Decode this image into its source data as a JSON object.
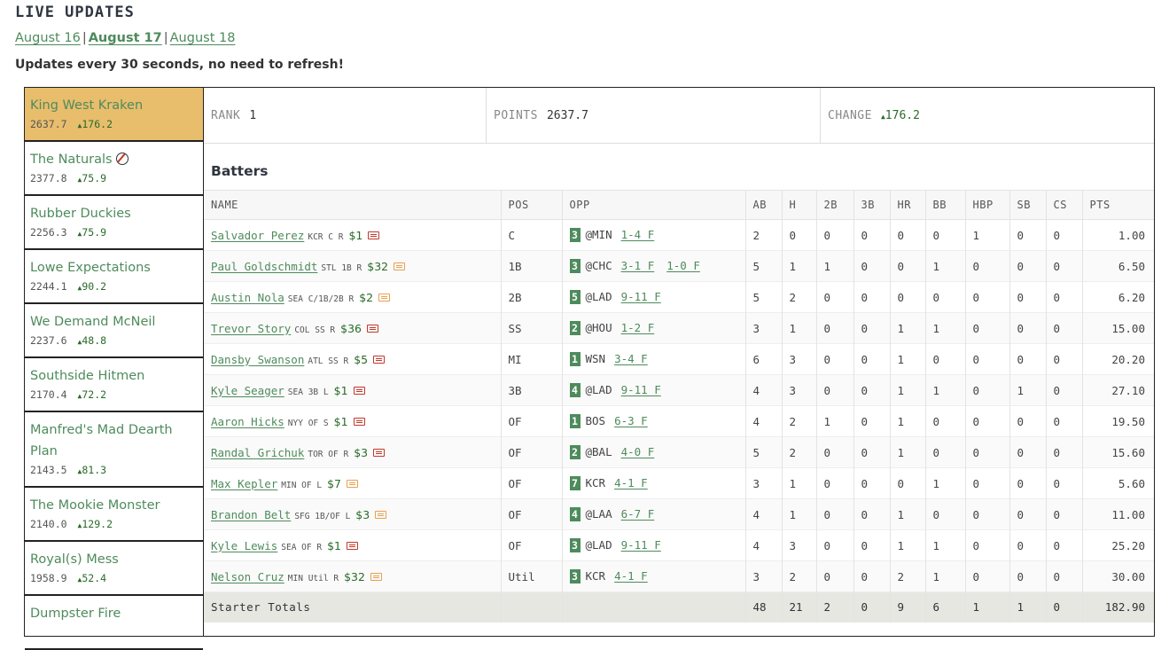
{
  "page_title": "LIVE UPDATES",
  "dates": [
    {
      "label": "August 16",
      "active": false
    },
    {
      "label": "August 17",
      "active": true
    },
    {
      "label": "August 18",
      "active": false
    }
  ],
  "date_separator": "|",
  "refresh_note": "Updates every 30 seconds, no need to refresh!",
  "teams": [
    {
      "name": "King West Kraken",
      "points": "2637.7",
      "change": "176.2",
      "active": true
    },
    {
      "name": "The Naturals",
      "points": "2377.8",
      "change": "75.9",
      "icon": "baseball-icon"
    },
    {
      "name": "Rubber Duckies",
      "points": "2256.3",
      "change": "75.9"
    },
    {
      "name": "Lowe Expectations",
      "points": "2244.1",
      "change": "90.2"
    },
    {
      "name": "We Demand McNeil",
      "points": "2237.6",
      "change": "48.8"
    },
    {
      "name": "Southside Hitmen",
      "points": "2170.4",
      "change": "72.2"
    },
    {
      "name": "Manfred's Mad Dearth Plan",
      "points": "2143.5",
      "change": "81.3"
    },
    {
      "name": "The Mookie Monster",
      "points": "2140.0",
      "change": "129.2"
    },
    {
      "name": "Royal(s) Mess",
      "points": "1958.9",
      "change": "52.4"
    },
    {
      "name": "Dumpster Fire",
      "points": "",
      "change": ""
    }
  ],
  "summary": {
    "rank_label": "RANK",
    "rank": "1",
    "points_label": "POINTS",
    "points": "2637.7",
    "change_label": "CHANGE",
    "change": "176.2"
  },
  "batters_title": "Batters",
  "columns": [
    "NAME",
    "POS",
    "OPP",
    "AB",
    "H",
    "2B",
    "3B",
    "HR",
    "BB",
    "HBP",
    "SB",
    "CS",
    "PTS"
  ],
  "batters": [
    {
      "name": "Salvador Perez",
      "team": "KCR",
      "elig": "C",
      "hand": "R",
      "salary": "$1",
      "card": "red",
      "pos": "C",
      "order": "3",
      "opp": "@MIN",
      "games": [
        "1-4 F"
      ],
      "stats": [
        "2",
        "0",
        "0",
        "0",
        "0",
        "0",
        "1",
        "0",
        "0"
      ],
      "pts": "1.00"
    },
    {
      "name": "Paul Goldschmidt",
      "team": "STL",
      "elig": "1B",
      "hand": "R",
      "salary": "$32",
      "card": "orange",
      "pos": "1B",
      "order": "3",
      "opp": "@CHC",
      "games": [
        "3-1 F",
        "1-0 F"
      ],
      "stats": [
        "5",
        "1",
        "1",
        "0",
        "0",
        "1",
        "0",
        "0",
        "0"
      ],
      "pts": "6.50"
    },
    {
      "name": "Austin Nola",
      "team": "SEA",
      "elig": "C/1B/2B",
      "hand": "R",
      "salary": "$2",
      "card": "orange",
      "pos": "2B",
      "order": "5",
      "opp": "@LAD",
      "games": [
        "9-11 F"
      ],
      "stats": [
        "5",
        "2",
        "0",
        "0",
        "0",
        "0",
        "0",
        "0",
        "0"
      ],
      "pts": "6.20"
    },
    {
      "name": "Trevor Story",
      "team": "COL",
      "elig": "SS",
      "hand": "R",
      "salary": "$36",
      "card": "red",
      "pos": "SS",
      "order": "2",
      "opp": "@HOU",
      "games": [
        "1-2 F"
      ],
      "stats": [
        "3",
        "1",
        "0",
        "0",
        "1",
        "1",
        "0",
        "0",
        "0"
      ],
      "pts": "15.00"
    },
    {
      "name": "Dansby Swanson",
      "team": "ATL",
      "elig": "SS",
      "hand": "R",
      "salary": "$5",
      "card": "red",
      "pos": "MI",
      "order": "1",
      "opp": "WSN",
      "games": [
        "3-4 F"
      ],
      "stats": [
        "6",
        "3",
        "0",
        "0",
        "1",
        "0",
        "0",
        "0",
        "0"
      ],
      "pts": "20.20"
    },
    {
      "name": "Kyle Seager",
      "team": "SEA",
      "elig": "3B",
      "hand": "L",
      "salary": "$1",
      "card": "red",
      "pos": "3B",
      "order": "4",
      "opp": "@LAD",
      "games": [
        "9-11 F"
      ],
      "stats": [
        "4",
        "3",
        "0",
        "0",
        "1",
        "1",
        "0",
        "1",
        "0"
      ],
      "pts": "27.10"
    },
    {
      "name": "Aaron Hicks",
      "team": "NYY",
      "elig": "OF",
      "hand": "S",
      "salary": "$1",
      "card": "red",
      "pos": "OF",
      "order": "1",
      "opp": "BOS",
      "games": [
        "6-3 F"
      ],
      "stats": [
        "4",
        "2",
        "1",
        "0",
        "1",
        "0",
        "0",
        "0",
        "0"
      ],
      "pts": "19.50"
    },
    {
      "name": "Randal Grichuk",
      "team": "TOR",
      "elig": "OF",
      "hand": "R",
      "salary": "$3",
      "card": "red",
      "pos": "OF",
      "order": "2",
      "opp": "@BAL",
      "games": [
        "4-0 F"
      ],
      "stats": [
        "5",
        "2",
        "0",
        "0",
        "1",
        "0",
        "0",
        "0",
        "0"
      ],
      "pts": "15.60"
    },
    {
      "name": "Max Kepler",
      "team": "MIN",
      "elig": "OF",
      "hand": "L",
      "salary": "$7",
      "card": "orange",
      "pos": "OF",
      "order": "7",
      "opp": "KCR",
      "games": [
        "4-1 F"
      ],
      "stats": [
        "3",
        "1",
        "0",
        "0",
        "0",
        "1",
        "0",
        "0",
        "0"
      ],
      "pts": "5.60"
    },
    {
      "name": "Brandon Belt",
      "team": "SFG",
      "elig": "1B/OF",
      "hand": "L",
      "salary": "$3",
      "card": "orange",
      "pos": "OF",
      "order": "4",
      "opp": "@LAA",
      "games": [
        "6-7 F"
      ],
      "stats": [
        "4",
        "1",
        "0",
        "0",
        "1",
        "0",
        "0",
        "0",
        "0"
      ],
      "pts": "11.00"
    },
    {
      "name": "Kyle Lewis",
      "team": "SEA",
      "elig": "OF",
      "hand": "R",
      "salary": "$1",
      "card": "red",
      "pos": "OF",
      "order": "3",
      "opp": "@LAD",
      "games": [
        "9-11 F"
      ],
      "stats": [
        "4",
        "3",
        "0",
        "0",
        "1",
        "1",
        "0",
        "0",
        "0"
      ],
      "pts": "25.20"
    },
    {
      "name": "Nelson Cruz",
      "team": "MIN",
      "elig": "Util",
      "hand": "R",
      "salary": "$32",
      "card": "orange",
      "pos": "Util",
      "order": "3",
      "opp": "KCR",
      "games": [
        "4-1 F"
      ],
      "stats": [
        "3",
        "2",
        "0",
        "0",
        "2",
        "1",
        "0",
        "0",
        "0"
      ],
      "pts": "30.00"
    }
  ],
  "totals": {
    "label": "Starter Totals",
    "stats": [
      "48",
      "21",
      "2",
      "0",
      "9",
      "6",
      "1",
      "1",
      "0"
    ],
    "pts": "182.90"
  },
  "colors": {
    "accent": "#4e8b5c",
    "active_team": "#e8bd6c",
    "positive": "#2a6b2a"
  }
}
